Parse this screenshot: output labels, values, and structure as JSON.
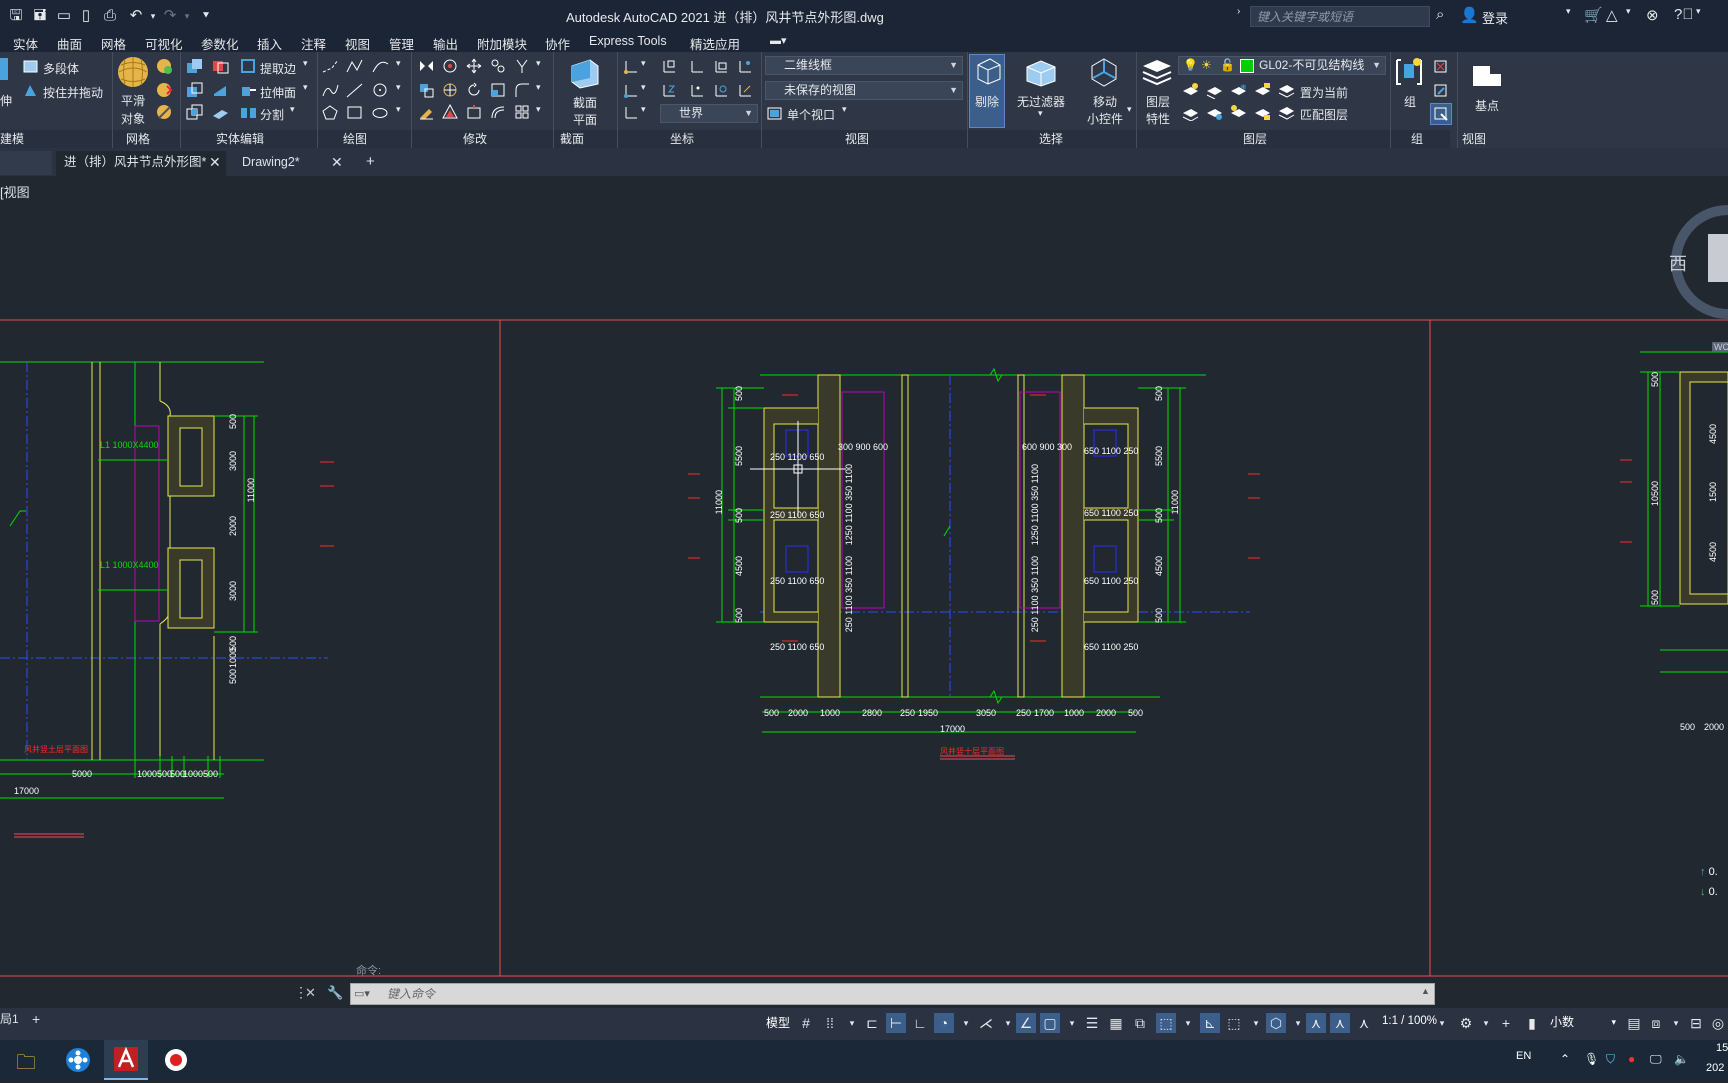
{
  "title_bar": {
    "app_title": "Autodesk AutoCAD 2021    进（排）风井节点外形图.dwg",
    "search_placeholder": "键入关键字或短语",
    "sign_in": "登录"
  },
  "menu_tabs": [
    "实体",
    "曲面",
    "网格",
    "可视化",
    "参数化",
    "插入",
    "注释",
    "视图",
    "管理",
    "输出",
    "附加模块",
    "协作",
    "Express Tools",
    "精选应用"
  ],
  "ribbon": {
    "panels": [
      {
        "title": "建模"
      },
      {
        "title": "网格"
      },
      {
        "title": "实体编辑"
      },
      {
        "title": "绘图"
      },
      {
        "title": "修改"
      },
      {
        "title": "截面"
      },
      {
        "title": "坐标"
      },
      {
        "title": "视图"
      },
      {
        "title": "选择"
      },
      {
        "title": "图层"
      },
      {
        "title": "组"
      },
      {
        "title": "视图"
      }
    ],
    "modeling": {
      "polysolid": "多段体",
      "presspull": "按住并拖动",
      "left_partial": "伸"
    },
    "mesh": {
      "smooth_line1": "平滑",
      "smooth_line2": "对象"
    },
    "solid_edit": {
      "extract_edges": "提取边",
      "extrude_faces": "拉伸面",
      "separate": "分割"
    },
    "section": {
      "plane_line1": "截面",
      "plane_line2": "平面"
    },
    "coords": {
      "world": "世界"
    },
    "view": {
      "visual_style": "二维线框",
      "named_view": "未保存的视图",
      "single_viewport": "单个视口"
    },
    "selection": {
      "cull": "剔除",
      "no_filter": "无过滤器",
      "gizmo_line1": "移动",
      "gizmo_line2": "小控件"
    },
    "layers": {
      "props_line1": "图层",
      "props_line2": "特性",
      "current_layer": "GL02-不可见结构线",
      "make_current": "置为当前",
      "match_layer": "匹配图层"
    },
    "groups": {
      "group": "组"
    },
    "view2": {
      "base": "基点"
    }
  },
  "file_tabs": [
    {
      "label": "进（排）风井节点外形图*",
      "active": true
    },
    {
      "label": "Drawing2*",
      "active": false
    }
  ],
  "viewport_label": "[视图",
  "viewcube": {
    "west": "西",
    "wcs": "WCS"
  },
  "drawing": {
    "left": {
      "dims_bottom": [
        "5000",
        "1000",
        "500",
        "500",
        "1000",
        "500"
      ],
      "total": "17000",
      "dims_right": [
        "500",
        "3000",
        "2000",
        "3000",
        "500",
        "1000",
        "500"
      ],
      "overall_right": "11000",
      "beam_labels": [
        "L1 1000X4400",
        "L1 1000X4400"
      ],
      "caption": "风井竖土层平面图"
    },
    "center": {
      "dims_bottom": [
        "500",
        "2000",
        "1000",
        "2800",
        "250",
        "1950",
        "3050",
        "250",
        "1700",
        "1000",
        "2000",
        "500"
      ],
      "total": "17000",
      "dims_left": [
        "500",
        "5500",
        "500",
        "4500",
        "500"
      ],
      "overall_left": "11000",
      "dims_right": [
        "500",
        "5500",
        "500",
        "4500",
        "500"
      ],
      "overall_right": "11000",
      "opening_dims_left": [
        "250 1100  650",
        "250 1100  650",
        "250 1100  650",
        "250 1100  650"
      ],
      "opening_dims_right": [
        "650  1100  250",
        "650 1100 250",
        "650  1100  250",
        "650 1100 250"
      ],
      "top_left_dims": "300 900 600",
      "top_right_dims": "600 900 300",
      "vertical_texts": [
        "1250  1100  350  1100",
        "250 1100  350 1100",
        "1250 1100 350 1100",
        "250 1100 350 1100"
      ],
      "caption": "风井竖十层平面图"
    },
    "right": {
      "dims_left": [
        "500",
        "10500",
        "500"
      ],
      "dims_right": [
        "4500",
        "1500",
        "4500"
      ],
      "dims_bottom": [
        "500",
        "2000"
      ]
    }
  },
  "command": {
    "hint": "命令:",
    "placeholder": "键入命令"
  },
  "layout_tabs": {
    "current": "局1",
    "add": "+"
  },
  "status_bar": {
    "model": "模型",
    "scale": "1:1 / 100%",
    "units": "小数"
  },
  "right_coords": [
    "0.",
    "0."
  ],
  "taskbar": {
    "ime": "EN",
    "time_fragment": "15",
    "date_fragment": "202"
  },
  "colors": {
    "canvas": "#212830",
    "ribbon": "#2f3746",
    "titlebar": "#1b2535",
    "accent": "#4aa3df",
    "cad_green": "#00e000",
    "cad_yellow": "#e8e84a",
    "cad_red": "#ff2a2a",
    "cad_blue": "#2a2aff",
    "cad_magenta": "#c000c0"
  }
}
